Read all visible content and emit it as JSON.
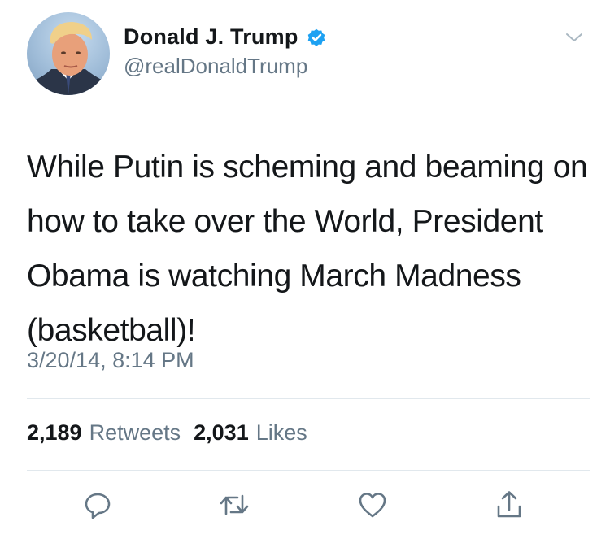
{
  "author": {
    "display_name": "Donald J. Trump",
    "handle": "@realDonaldTrump",
    "verified": true,
    "avatar_icon": "profile-photo",
    "verified_icon": "verified-badge-icon"
  },
  "tweet": {
    "text": "While Putin is scheming and beaming on how to take over the World, President Obama is watching March Madness (basketball)!",
    "timestamp": "3/20/14, 8:14 PM"
  },
  "stats": {
    "retweets_count": "2,189",
    "retweets_label": "Retweets",
    "likes_count": "2,031",
    "likes_label": "Likes"
  },
  "actions": [
    {
      "name": "reply",
      "icon": "reply-icon"
    },
    {
      "name": "retweet",
      "icon": "retweet-icon"
    },
    {
      "name": "like",
      "icon": "heart-icon"
    },
    {
      "name": "share",
      "icon": "share-icon"
    }
  ],
  "colors": {
    "text_primary": "#14171a",
    "text_secondary": "#657786",
    "verified_blue": "#1da1f2",
    "divider": "#e1e8ed",
    "icon_gray": "#657786"
  }
}
